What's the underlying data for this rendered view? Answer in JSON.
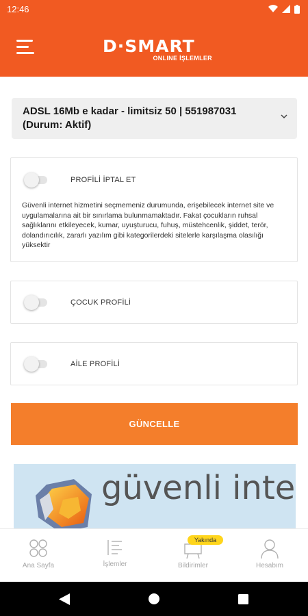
{
  "status_bar": {
    "time": "12:46"
  },
  "header": {
    "logo_main": "D·SMART",
    "logo_sub": "ONLINE İŞLEMLER"
  },
  "package_select": {
    "line1": "ADSL 16Mb e kadar - limitsiz 50 | 551987031",
    "line2": "(Durum: Aktif)"
  },
  "profiles": {
    "cancel": {
      "label": "PROFİLİ İPTAL ET",
      "on": false,
      "description": "Güvenli internet hizmetini seçmemeniz durumunda, erişebilecek internet site ve uygulamalarına ait bir sınırlama bulunmamaktadır. Fakat çocukların ruhsal sağlıklarını etkileyecek, kumar, uyuşturucu, fuhuş, müstehcenlik, şiddet, terör, dolandırıcılık, zararlı yazılım gibi kategorilerdeki sitelerle karşılaşma olasılığı yüksektir"
    },
    "child": {
      "label": "ÇOCUK PROFİLİ",
      "on": false
    },
    "family": {
      "label": "AİLE PROFİLİ",
      "on": false
    }
  },
  "update_button": {
    "label": "GÜNCELLE"
  },
  "banner": {
    "text": "güvenli internet"
  },
  "bottom_nav": {
    "items": [
      {
        "label": "Ana Sayfa",
        "icon": "home-circles-icon"
      },
      {
        "label": "İşlemler",
        "icon": "list-icon"
      },
      {
        "label": "Bildirimler",
        "icon": "notification-icon",
        "badge": "Yakında"
      },
      {
        "label": "Hesabım",
        "icon": "person-icon"
      }
    ]
  },
  "colors": {
    "brand": "#f15a22",
    "button": "#f47e2b",
    "badge": "#ffd51c"
  }
}
